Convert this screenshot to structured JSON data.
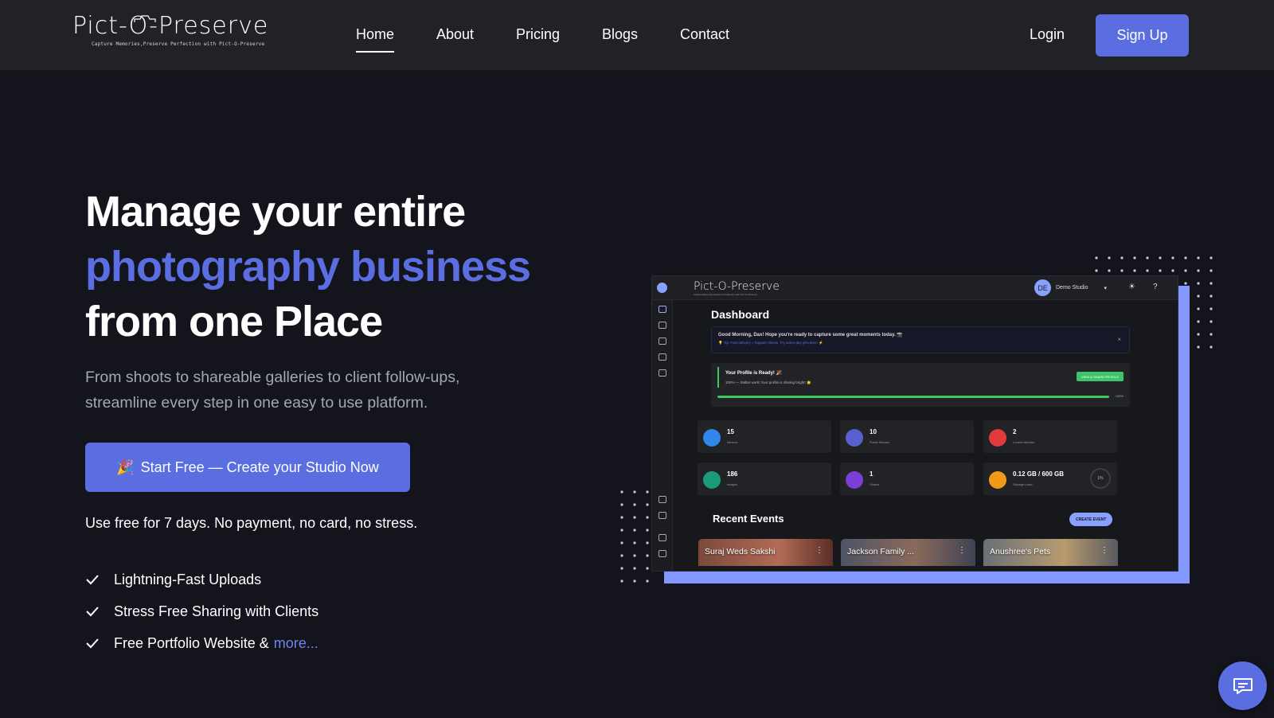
{
  "nav": {
    "logo_title": "Pict-O-Preserve",
    "logo_tagline": "Capture Memories,Preserve Perfection with Pict-O-Preserve",
    "links": [
      "Home",
      "About",
      "Pricing",
      "Blogs",
      "Contact"
    ],
    "active_link": "Home",
    "login_label": "Login",
    "signup_label": "Sign Up"
  },
  "hero": {
    "headline_line1": "Manage your entire",
    "headline_accent": "photography business",
    "headline_line3": "from one Place",
    "subtext": "From shoots to shareable galleries to client follow-ups, streamline every step in one easy to use platform.",
    "cta_emoji": "🎉",
    "cta_label": "Start Free — Create your Studio Now",
    "note": "Use free for 7 days. No payment, no card, no stress.",
    "features": [
      "Lightning-Fast Uploads",
      "Stress Free Sharing with Clients",
      "Free Portfolio Website &"
    ],
    "more_link": "more..."
  },
  "dashboard": {
    "app_title": "Pict-O-Preserve",
    "app_tagline": "Capture Memories,Preserve Perfection with Pict-O-Preserve",
    "user_initials": "DE",
    "studio_name": "Demo Studio",
    "heading": "Dashboard",
    "greeting": "Good Morning, Dax! Hope you're ready to capture some great moments today. 📸",
    "tip": "💡 Tip: Fast delivery = happier clients. Try same-day previews! ⚡",
    "profile_title": "Your Profile is Ready! 🎉",
    "profile_sub": "100% — Stellar work! Your profile is shining bright! 🌟",
    "profile_button": "VIEW & SHARE PROFILE",
    "profile_progress": 100,
    "profile_progress_label": "100%",
    "stats": [
      {
        "value": "15",
        "label": "Albums",
        "color": "#2f86eb"
      },
      {
        "value": "10",
        "label": "Public Albums",
        "color": "#5a5fd0"
      },
      {
        "value": "2",
        "label": "Locked Albums",
        "color": "#e23b3b"
      },
      {
        "value": "186",
        "label": "Images",
        "color": "#1a9c7a"
      },
      {
        "value": "1",
        "label": "Videos",
        "color": "#7b3fd4"
      },
      {
        "value": "0.12 GB / 600 GB",
        "label": "Storage Used",
        "color": "#f29a18"
      }
    ],
    "storage_pct": "1%",
    "recent_events_heading": "Recent Events",
    "create_event_label": "CREATE EVENT",
    "events": [
      "Suraj Weds Sakshi",
      "Jackson Family ...",
      "Anushree's Pets"
    ]
  },
  "colors": {
    "accent": "#5b6ee1",
    "background": "#14151c",
    "navbar": "#212225",
    "frame": "#8496ff"
  },
  "icons": [
    "camera-icon",
    "check-icon",
    "chat-icon",
    "grid-icon",
    "sun-icon",
    "help-icon",
    "close-icon"
  ]
}
